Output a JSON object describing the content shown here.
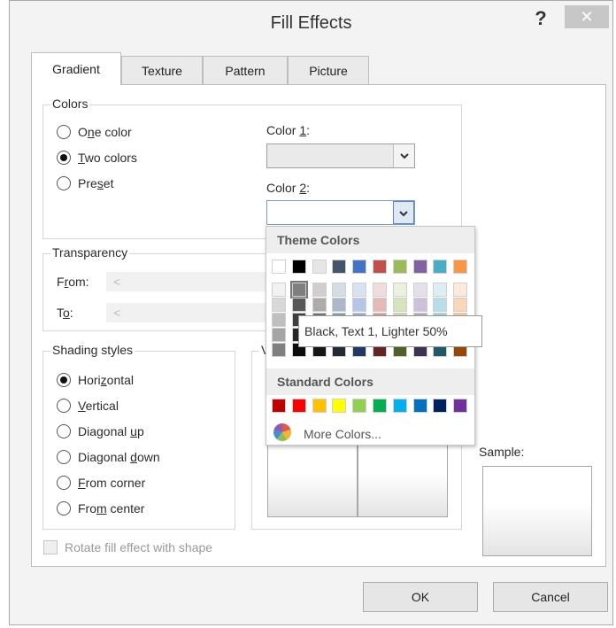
{
  "title": "Fill Effects",
  "titlebar": {
    "help": "?",
    "close": "✕"
  },
  "tabs": [
    {
      "label": "Gradient",
      "active": true
    },
    {
      "label": "Texture",
      "active": false
    },
    {
      "label": "Pattern",
      "active": false
    },
    {
      "label": "Picture",
      "active": false
    }
  ],
  "colors_group": {
    "label": "Colors",
    "options": [
      {
        "pre": "O",
        "u": "n",
        "post": "e color",
        "selected": false
      },
      {
        "pre": "",
        "u": "T",
        "post": "wo colors",
        "selected": true
      },
      {
        "pre": "Pre",
        "u": "s",
        "post": "et",
        "selected": false
      }
    ],
    "color1_label": {
      "pre": "Color ",
      "u": "1",
      "post": ":"
    },
    "color2_label": {
      "pre": "Color ",
      "u": "2",
      "post": ":"
    }
  },
  "transparency": {
    "label": "Transparency",
    "from": {
      "pre": "F",
      "u": "r",
      "post": "om:"
    },
    "to": {
      "pre": "T",
      "u": "o",
      "post": ":"
    },
    "slider_arrow": "<"
  },
  "shading": {
    "label": "Shading styles",
    "options": [
      {
        "pre": "Hori",
        "u": "z",
        "post": "ontal",
        "selected": true
      },
      {
        "pre": "",
        "u": "V",
        "post": "ertical",
        "selected": false
      },
      {
        "pre": "Diagonal ",
        "u": "u",
        "post": "p",
        "selected": false
      },
      {
        "pre": "Diagonal ",
        "u": "d",
        "post": "own",
        "selected": false
      },
      {
        "pre": "",
        "u": "F",
        "post": "rom corner",
        "selected": false
      },
      {
        "pre": "Fro",
        "u": "m",
        "post": " center",
        "selected": false
      }
    ],
    "variants_label": "V"
  },
  "sample_label": "Sample:",
  "rotate_checkbox": "Rotate fill effect with shape",
  "buttons": {
    "ok": "OK",
    "cancel": "Cancel"
  },
  "color_dropdown": {
    "theme_header": "Theme Colors",
    "standard_header": "Standard Colors",
    "more_colors": "More Colors...",
    "tooltip": "Black, Text 1, Lighter 50%",
    "theme_top": [
      "#ffffff",
      "#000000",
      "#e7e6e6",
      "#44546a",
      "#4472c4",
      "#c0504d",
      "#9bbb59",
      "#8064a2",
      "#4bacc6",
      "#f79646"
    ],
    "theme_shades": [
      [
        "#f2f2f2",
        "#7f7f7f",
        "#d0cece",
        "#d6dce4",
        "#d9e2f3",
        "#f2dcdb",
        "#ebf1dd",
        "#e5e0ec",
        "#dbeef3",
        "#fdeada"
      ],
      [
        "#d8d8d8",
        "#595959",
        "#aeabab",
        "#adb9ca",
        "#b4c6e7",
        "#e5b9b7",
        "#d7e3bc",
        "#ccc1d9",
        "#b7dde8",
        "#fbd5b5"
      ],
      [
        "#bfbfbf",
        "#3f3f3f",
        "#757070",
        "#8496b0",
        "#8eaadb",
        "#d99694",
        "#c3d69b",
        "#b2a2c7",
        "#92cddc",
        "#fac08f"
      ],
      [
        "#a5a5a5",
        "#262626",
        "#3a3838",
        "#323f4f",
        "#2f5496",
        "#953734",
        "#76923c",
        "#5f497a",
        "#31859b",
        "#e36c09"
      ],
      [
        "#7f7f7f",
        "#0c0c0c",
        "#171616",
        "#222a35",
        "#1f3864",
        "#632423",
        "#4f6128",
        "#3f3151",
        "#205867",
        "#974806"
      ]
    ],
    "standard": [
      "#c00000",
      "#ff0000",
      "#ffc000",
      "#ffff00",
      "#92d050",
      "#00b050",
      "#00b0f0",
      "#0070c0",
      "#002060",
      "#7030a0"
    ],
    "selected_swatch": "Black, Text 1, Lighter 50%"
  }
}
